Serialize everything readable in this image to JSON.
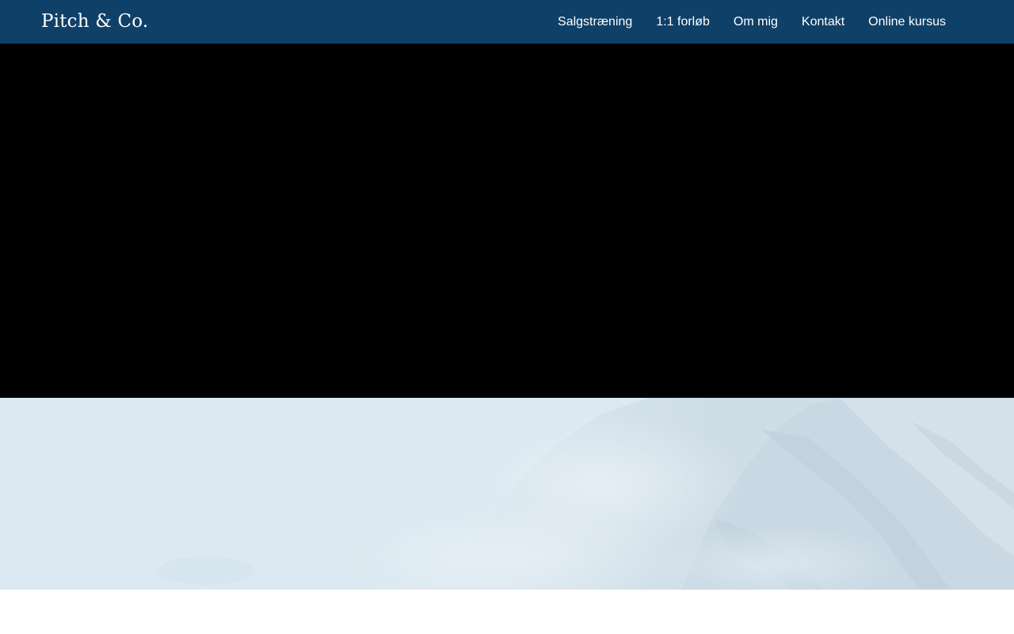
{
  "header": {
    "logo": "Pitch & Co.",
    "nav": [
      {
        "label": "Salgstræning"
      },
      {
        "label": "1:1 forløb"
      },
      {
        "label": "Om mig"
      },
      {
        "label": "Kontakt"
      },
      {
        "label": "Online kursus"
      }
    ]
  },
  "colors": {
    "header_bg": "#0f4068",
    "header_text": "#ffffff",
    "video_bg": "#000000",
    "band_bg": "#dce9f2"
  }
}
